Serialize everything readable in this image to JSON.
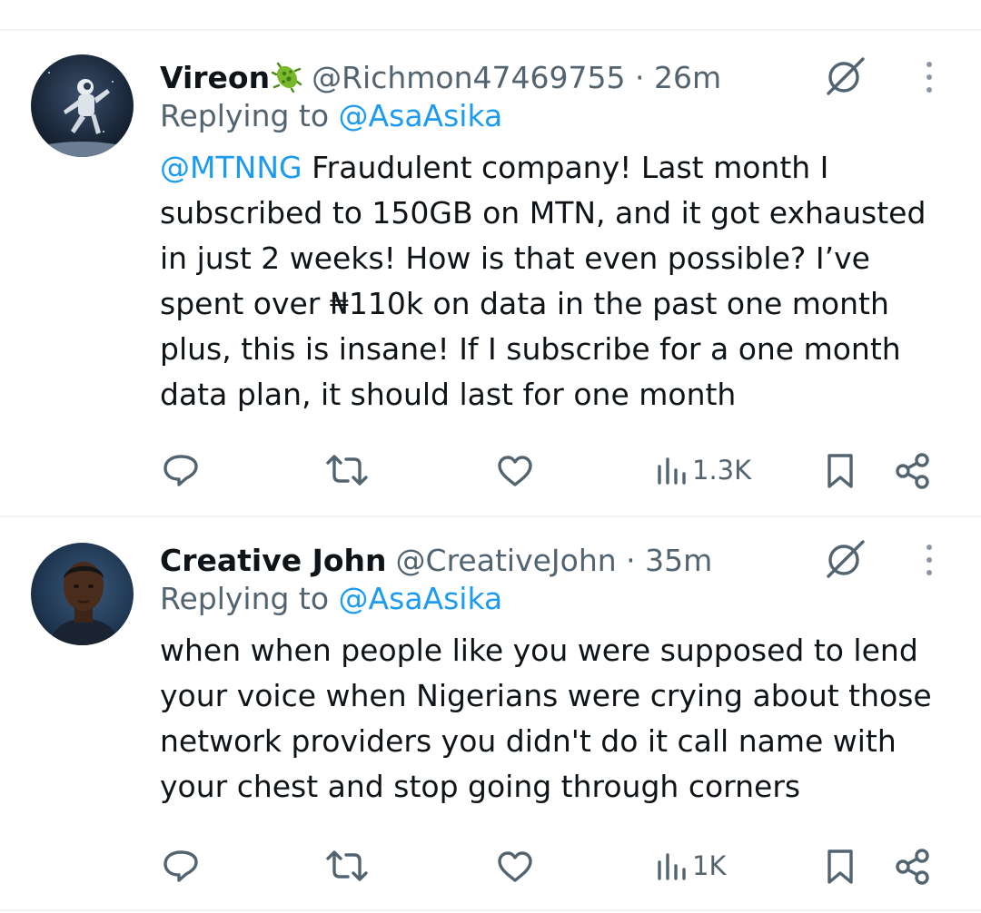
{
  "tweets": [
    {
      "name": "Vireon",
      "emoji": "microbe-emoji",
      "handle": "@Richmon47469755",
      "separator": " · ",
      "time": "26m",
      "replying_prefix": "Replying to ",
      "replying_to": "@AsaAsika",
      "mention": "@MTNNG",
      "text_lines": [
        " Fraudulent company! Last month I",
        "subscribed to 150GB on MTN, and it got exhausted",
        "in just 2 weeks! How is that even possible? I’ve",
        "spent over ₦110k on data in the past one month",
        "plus, this is insane! If I subscribe for a one month",
        "data plan, it should last for one month"
      ],
      "views": "1.3K"
    },
    {
      "name": "Creative John",
      "handle": "@CreativeJohn",
      "separator": " · ",
      "time": "35m",
      "replying_prefix": "Replying to ",
      "replying_to": "@AsaAsika",
      "text_lines": [
        "when when people like you were supposed to lend",
        "your voice when Nigerians were crying about those",
        "network providers you didn't do it call name with",
        "your chest and stop going through corners"
      ],
      "views": "1K"
    }
  ],
  "colors": {
    "text": "#0f1419",
    "secondary": "#536471",
    "link": "#1d9bf0",
    "separator": "#eff3f4"
  },
  "icons": [
    "reply-icon",
    "retweet-icon",
    "like-icon",
    "views-icon",
    "bookmark-icon",
    "share-icon",
    "grok-icon",
    "more-icon"
  ]
}
